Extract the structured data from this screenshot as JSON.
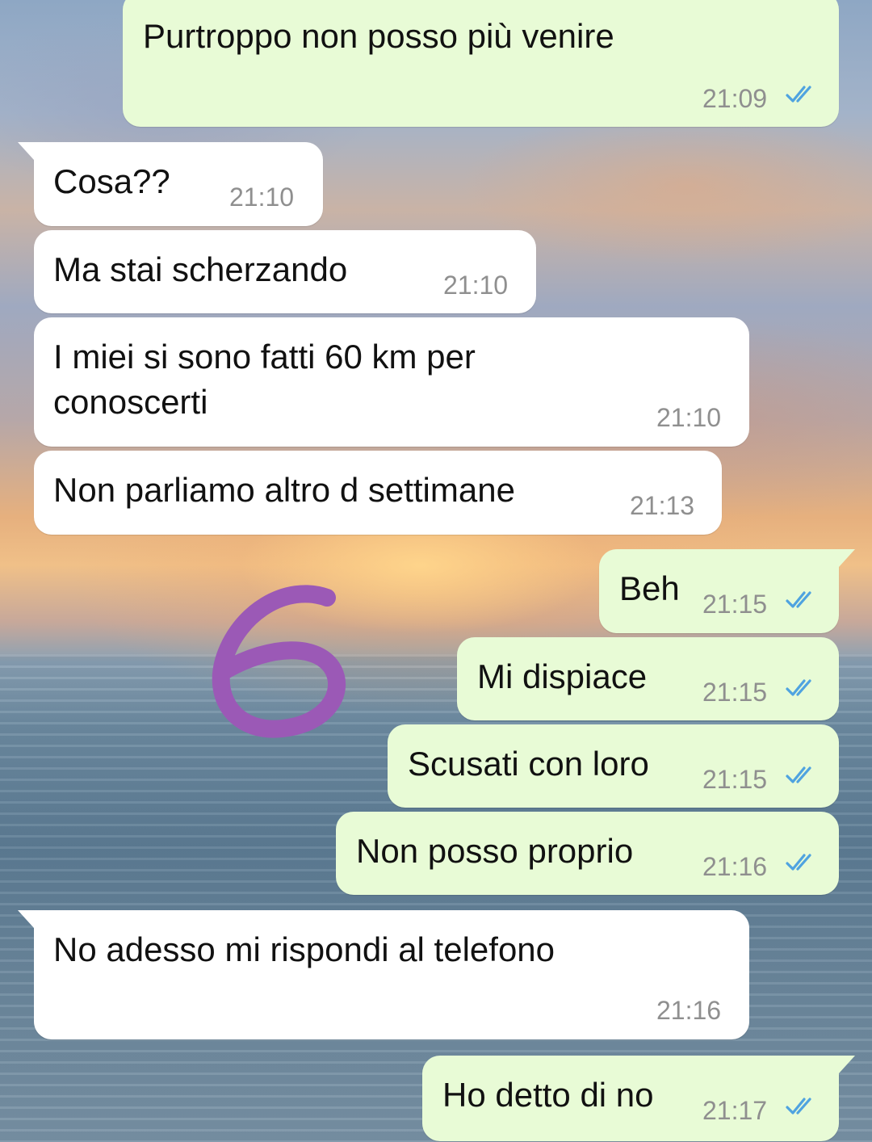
{
  "theme": {
    "incoming_bubble": "#ffffff",
    "outgoing_bubble": "#e8fbd6",
    "read_tick_color": "#4fa3e0",
    "timestamp_color": "#8f8f8f",
    "annotation_color": "#9b59b6"
  },
  "annotation": {
    "number": "6"
  },
  "messages": [
    {
      "direction": "outgoing",
      "text": "Purtroppo non posso più venire",
      "time": "21:09",
      "status": "read"
    },
    {
      "direction": "incoming",
      "text": "Cosa??",
      "time": "21:10"
    },
    {
      "direction": "incoming",
      "text": "Ma stai scherzando",
      "time": "21:10"
    },
    {
      "direction": "incoming",
      "text_lines": [
        "I miei si sono fatti 60 km per",
        "conoscerti"
      ],
      "time": "21:10"
    },
    {
      "direction": "incoming",
      "text": "Non parliamo altro d settimane",
      "time": "21:13"
    },
    {
      "direction": "outgoing",
      "text": "Beh",
      "time": "21:15",
      "status": "read"
    },
    {
      "direction": "outgoing",
      "text": "Mi dispiace",
      "time": "21:15",
      "status": "read"
    },
    {
      "direction": "outgoing",
      "text": "Scusati con loro",
      "time": "21:15",
      "status": "read"
    },
    {
      "direction": "outgoing",
      "text": "Non posso proprio",
      "time": "21:16",
      "status": "read"
    },
    {
      "direction": "incoming",
      "text": "No adesso mi rispondi al telefono",
      "time": "21:16"
    },
    {
      "direction": "outgoing",
      "text": "Ho detto di no",
      "time": "21:17",
      "status": "read"
    }
  ]
}
